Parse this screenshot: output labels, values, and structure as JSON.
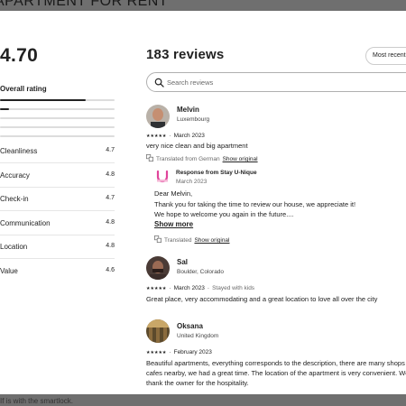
{
  "background": {
    "page_title": "APARTMENT FOR RENT",
    "footer_text": "If is with the smartlock."
  },
  "summary": {
    "overall_score": "4.70",
    "overall_label": "Overall rating",
    "distribution": [
      {
        "stars": 5,
        "fraction": 0.75
      },
      {
        "stars": 4,
        "fraction": 0.08
      },
      {
        "stars": 3,
        "fraction": 0.0
      },
      {
        "stars": 2,
        "fraction": 0.0
      },
      {
        "stars": 1,
        "fraction": 0.0
      }
    ],
    "categories": [
      {
        "label": "Cleanliness",
        "value": "4.7"
      },
      {
        "label": "Accuracy",
        "value": "4.8"
      },
      {
        "label": "Check-in",
        "value": "4.7"
      },
      {
        "label": "Communication",
        "value": "4.8"
      },
      {
        "label": "Location",
        "value": "4.8"
      },
      {
        "label": "Value",
        "value": "4.6"
      }
    ]
  },
  "reviews_header": {
    "count_label": "183 reviews",
    "sort_label": "Most recent"
  },
  "search": {
    "placeholder": "Search reviews",
    "value": ""
  },
  "reviews": [
    {
      "name": "Melvin",
      "location": "Luxembourg",
      "stars": "★★★★★",
      "date": "March 2023",
      "text": "very nice clean and big apartment",
      "translated_label": "Translated from German",
      "show_original": "Show original",
      "response": {
        "title": "Response from Stay U-Nique",
        "date": "March 2023",
        "lines": [
          "Dear Melvin,",
          "Thank you for taking the time to review our house, we appreciate it!",
          "We hope to welcome you again in the future...."
        ],
        "show_more": "Show more",
        "translated_label": "Translated",
        "show_original": "Show original"
      }
    },
    {
      "name": "Sal",
      "location": "Boulder, Colorado",
      "stars": "★★★★★",
      "date": "March 2023",
      "stay_note": "Stayed with kids",
      "text": "Great place, very accommodating and a great location to love all over the city"
    },
    {
      "name": "Oksana",
      "location": "United Kingdom",
      "stars": "★★★★★",
      "date": "February 2023",
      "lines": [
        "Beautiful apartments, everything corresponds to the description, there are many shops and",
        "cafes nearby, we had a great time. The location of the apartment is very convenient. We",
        "thank the owner for the hospitality."
      ]
    }
  ],
  "colors": {
    "text": "#222222",
    "muted": "#6a6a6a",
    "divider": "#dddddd",
    "overlay": "#6f6f6f",
    "host_logo": "#e0459b"
  }
}
